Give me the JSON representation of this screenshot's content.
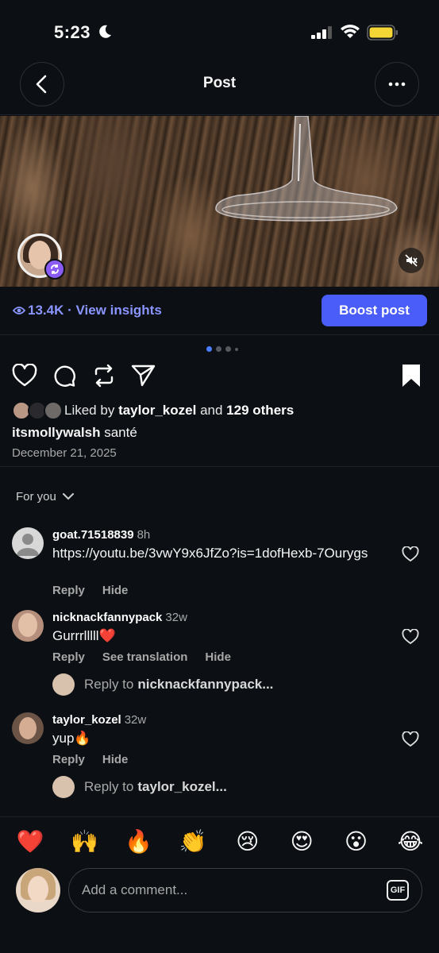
{
  "status_bar": {
    "time": "5:23"
  },
  "header": {
    "title": "Post"
  },
  "insights": {
    "views": "13.4K · View insights",
    "boost_label": "Boost post"
  },
  "post": {
    "liked_by_prefix": "Liked by",
    "liked_by_user": "taylor_kozel",
    "liked_by_and": "and",
    "liked_by_others": "129 others",
    "caption_user": "itsmollywalsh",
    "caption_text": "santé",
    "date": "December 21, 2025"
  },
  "filter": {
    "label": "For you"
  },
  "comments": [
    {
      "user": "goat.71518839",
      "age": "8h",
      "text": "https://youtu.be/3vwY9x6JfZo?is=1dofHexb-7Ourygs",
      "actions": [
        "Reply",
        "Hide"
      ]
    },
    {
      "user": "nicknackfannypack",
      "age": "32w",
      "text": "Gurrrlllll❤️",
      "actions": [
        "Reply",
        "See translation",
        "Hide"
      ],
      "reply_prefix": "Reply to",
      "reply_user": "nicknackfannypack..."
    },
    {
      "user": "taylor_kozel",
      "age": "32w",
      "text": "yup🔥",
      "actions": [
        "Reply",
        "Hide"
      ],
      "reply_prefix": "Reply to",
      "reply_user": "taylor_kozel..."
    }
  ],
  "emoji_bar": [
    "❤️",
    "🙌",
    "🔥",
    "👏",
    "😢",
    "😍",
    "😮",
    "😂"
  ],
  "composer": {
    "placeholder": "Add a comment...",
    "gif_label": "GIF"
  },
  "colors": {
    "accent": "#4a5df9",
    "link": "#8a95ff",
    "background": "#0c1014",
    "badge": "#8a5cf5"
  }
}
